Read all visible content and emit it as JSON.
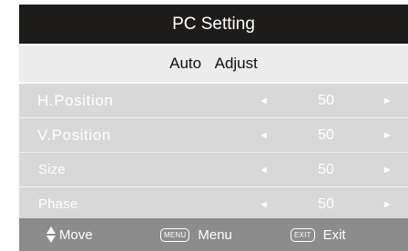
{
  "header": {
    "title": "PC Setting"
  },
  "subheader": {
    "label": "Auto  Adjust"
  },
  "settings": [
    {
      "label": "H.Position",
      "value": "50"
    },
    {
      "label": "V.Position",
      "value": "50"
    },
    {
      "label": "Size",
      "value": "50"
    },
    {
      "label": "Phase",
      "value": "50"
    }
  ],
  "glyphs": {
    "left_arrow": "◄",
    "right_arrow": "►"
  },
  "footer": {
    "move_label": "Move",
    "menu_key": "MENU",
    "menu_label": "Menu",
    "exit_key": "EXIT",
    "exit_label": "Exit"
  },
  "colors": {
    "title_bg": "#1e1c1a",
    "subtitle_bg": "#ececec",
    "row_bg": "#d8d8d8",
    "footer_bg": "#8c8c8c"
  }
}
